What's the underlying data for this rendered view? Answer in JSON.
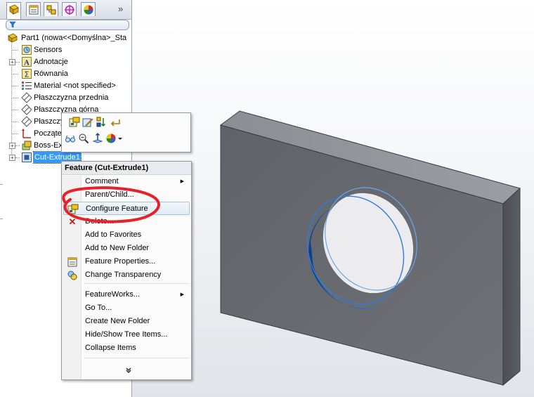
{
  "tree": {
    "root": "Part1  (nowa<<Domyślna>_Sta",
    "items": [
      {
        "label": "Sensors"
      },
      {
        "label": "Adnotacje"
      },
      {
        "label": "Równania"
      },
      {
        "label": "Material <not specified>"
      },
      {
        "label": "Płaszczyzna przednia"
      },
      {
        "label": "Płaszczyzna górna"
      },
      {
        "label": "Płaszczy"
      },
      {
        "label": "Począte"
      },
      {
        "label": "Boss-Ex"
      },
      {
        "label": "Cut-Extrude1"
      }
    ]
  },
  "menu": {
    "header": "Feature (Cut-Extrude1)",
    "items": [
      {
        "label": "Comment"
      },
      {
        "label": "Parent/Child..."
      },
      {
        "label": "Configure Feature"
      },
      {
        "label": "Delete..."
      },
      {
        "label": "Add to Favorites"
      },
      {
        "label": "Add to New Folder"
      },
      {
        "label": "Feature Properties..."
      },
      {
        "label": "Change Transparency"
      },
      {
        "label": "FeatureWorks..."
      },
      {
        "label": "Go To..."
      },
      {
        "label": "Create New Folder"
      },
      {
        "label": "Hide/Show Tree Items..."
      },
      {
        "label": "Collapse Items"
      }
    ],
    "expand": "»"
  },
  "tabs": {
    "more": "»"
  },
  "colors": {
    "selection": "#3399ff",
    "annotation": "#e8202a",
    "part_face": "#6c6e73",
    "hole_wall": "#1f5fb0"
  }
}
